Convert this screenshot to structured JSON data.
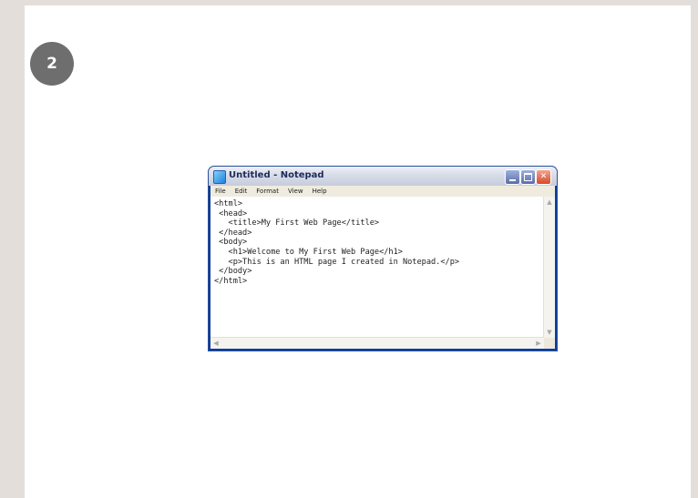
{
  "step": {
    "number": "2"
  },
  "notepad": {
    "title": "Untitled - Notepad",
    "menu": [
      "File",
      "Edit",
      "Format",
      "View",
      "Help"
    ],
    "content": "<html>\n <head>\n   <title>My First Web Page</title>\n </head>\n <body>\n   <h1>Welcome to My First Web Page</h1>\n   <p>This is an HTML page I created in Notepad.</p>\n </body>\n</html>",
    "controls": {
      "minimize": "minimize-icon",
      "maximize": "maximize-icon",
      "close": "close-icon",
      "close_glyph": "✕"
    }
  },
  "colors": {
    "page_background": "#e4dedb",
    "card_background": "#ffffff",
    "badge_background": "#6e6e6e",
    "window_frame": "#0e3c9c",
    "close_button": "#d8482a"
  }
}
